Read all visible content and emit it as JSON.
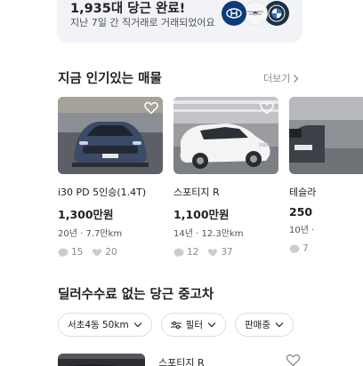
{
  "banner": {
    "title": "1,935대 당근 완료!",
    "subtitle": "지난 7일 간 직거래로 거래되었어요",
    "brands": [
      "hyundai-logo",
      "genesis-logo",
      "bmw-logo"
    ]
  },
  "popular": {
    "title": "지금 인기있는 매물",
    "more_label": "더보기",
    "items": [
      {
        "name": "i30 PD 5인승(1.4T)",
        "price": "1,300만원",
        "meta": "20년 · 7.7만km",
        "chats": "15",
        "likes": "20"
      },
      {
        "name": "스포티지 R",
        "price": "1,100만원",
        "meta": "14년 · 12.3만km",
        "chats": "12",
        "likes": "37"
      },
      {
        "name": "테슬라",
        "price": "250",
        "meta": "10년 ·",
        "chats": "7",
        "likes": ""
      }
    ]
  },
  "dealer": {
    "title": "딜러수수료 없는 당근 중고차",
    "filters": [
      {
        "label": "서초4동 50km",
        "icon": "chevron-down-icon"
      },
      {
        "label": "필터",
        "icon": "chevron-down-icon"
      },
      {
        "label": "판매중",
        "icon": "chevron-down-icon"
      }
    ],
    "listing": {
      "name": "스포티지 R"
    }
  },
  "colors": {
    "text": "#212124",
    "muted": "#868b94",
    "banner_bg": "#f2f3f6",
    "border": "#dcdee3"
  }
}
